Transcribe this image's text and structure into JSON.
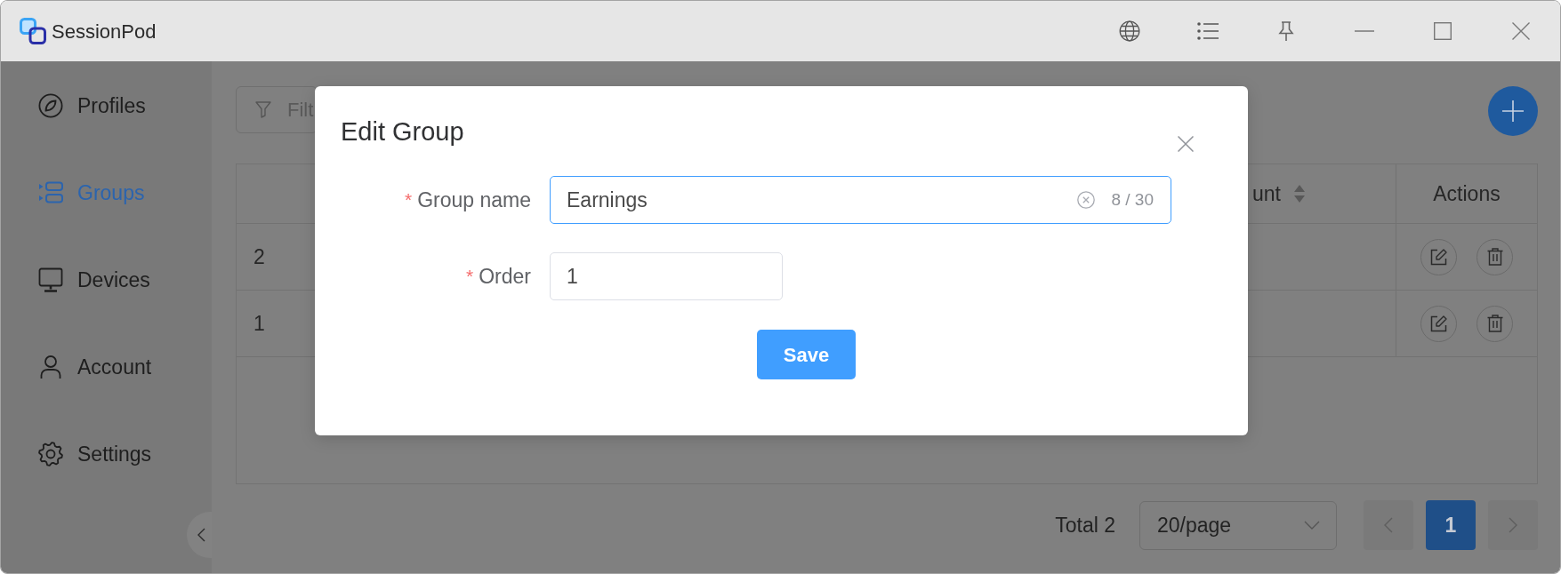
{
  "window": {
    "title": "SessionPod"
  },
  "sidebar": {
    "items": [
      {
        "label": "Profiles",
        "selected": false
      },
      {
        "label": "Groups",
        "selected": true
      },
      {
        "label": "Devices",
        "selected": false
      },
      {
        "label": "Account",
        "selected": false
      },
      {
        "label": "Settings",
        "selected": false
      }
    ]
  },
  "filter": {
    "placeholder": "Filt"
  },
  "table": {
    "columns": [
      {
        "label": "unt",
        "kind": "sortable"
      },
      {
        "label": "Actions",
        "kind": "plain"
      }
    ],
    "rows": [
      {
        "column_1": "2"
      },
      {
        "column_1": "1"
      }
    ]
  },
  "pagination": {
    "total": "Total 2",
    "page_size": "20/page",
    "pages": [
      {
        "label": "1",
        "selected": true
      }
    ]
  },
  "dialog": {
    "title": "Edit Group",
    "fields": [
      {
        "label": "Group name",
        "required_mark": "*",
        "value": "Earnings",
        "focused": true,
        "clearable": true,
        "counter": "8 / 30"
      },
      {
        "label": "Order",
        "required_mark": "*",
        "value": "1",
        "focused": false,
        "clearable": false
      }
    ],
    "buttons": [
      {
        "label": "Save"
      }
    ]
  }
}
